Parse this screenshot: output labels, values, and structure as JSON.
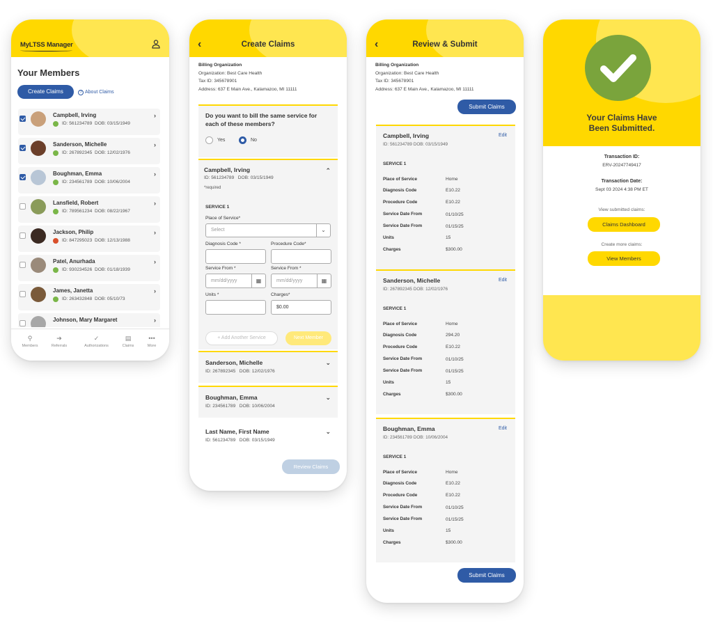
{
  "members_screen": {
    "logo": "MyLTSS Manager",
    "heading": "Your Members",
    "create_claims": "Create Claims",
    "about_claims": "About Claims",
    "members": [
      {
        "name": "Campbell, Irving",
        "id": "ID: 561234789",
        "dob": "DOB: 03/15/1949",
        "checked": true,
        "status": "ok"
      },
      {
        "name": "Sanderson, Michelle",
        "id": "ID: 267892345",
        "dob": "DOB: 12/02/1976",
        "checked": true,
        "status": "ok"
      },
      {
        "name": "Boughman, Emma",
        "id": "ID: 234561789",
        "dob": "DOB: 10/06/2004",
        "checked": true,
        "status": "ok"
      },
      {
        "name": "Lansfield, Robert",
        "id": "ID: 789561234",
        "dob": "DOB: 08/22/1967",
        "checked": false,
        "status": "ok"
      },
      {
        "name": "Jackson, Philip",
        "id": "ID: 847295023",
        "dob": "DOB: 12/13/1988",
        "checked": false,
        "status": "bad"
      },
      {
        "name": "Patel, Anurhada",
        "id": "ID: 930234526",
        "dob": "DOB: 01/18/1939",
        "checked": false,
        "status": "ok"
      },
      {
        "name": "James, Janetta",
        "id": "ID: 263432848",
        "dob": "DOB: 05/10/73",
        "checked": false,
        "status": "ok"
      },
      {
        "name": "Johnson, Mary Margaret",
        "id": "",
        "dob": "",
        "checked": false,
        "status": "ok"
      }
    ],
    "nav": [
      "Members",
      "Referrals",
      "Authorizations",
      "Claims",
      "More"
    ]
  },
  "create_screen": {
    "title": "Create Claims",
    "billing_label": "Billing Organization",
    "organization": "Organization:   Best Care Health",
    "tax_id": "Tax ID:   345678901",
    "address": "Address:   637 E Main Ave., Kalamazoo, MI 11111",
    "question": "Do you want to bill the same service for each of these members?",
    "yes": "Yes",
    "no": "No",
    "member": {
      "name": "Campbell, Irving",
      "id": "ID: 561234789",
      "dob": "DOB: 03/15/1949"
    },
    "required": "*required",
    "service": "SERVICE 1",
    "place_label": "Place of Service*",
    "place_placeholder": "Select",
    "diagnosis_label": "Diagnosis Code *",
    "procedure_label": "Procedure Code*",
    "service_from_label": "Service From *",
    "service_from_label2": "Service From *",
    "date_placeholder": "mm/dd/yyyy",
    "units_label": "Units *",
    "charges_label": "Charges*",
    "charges_value": "$0.00",
    "add_service": "+ Add Another Service",
    "next_member": "Next Member",
    "collapsed": [
      {
        "name": "Sanderson, Michelle",
        "id": "ID: 267892345",
        "dob": "DOB: 12/02/1976"
      },
      {
        "name": "Boughman, Emma",
        "id": "ID: 234561789",
        "dob": "DOB: 10/06/2004"
      },
      {
        "name": "Last Name, First Name",
        "id": "ID: 561234789",
        "dob": "DOB: 03/15/1949"
      }
    ],
    "review": "Review Claims"
  },
  "review_screen": {
    "title": "Review & Submit",
    "billing_label": "Billing Organization",
    "organization": "Organization:   Best Care Health",
    "tax_id": "Tax ID:   345678901",
    "address": "Address:   637 E Main Ave., Kalamazoo, MI 11111",
    "submit": "Submit Claims",
    "edit": "Edit",
    "service": "SERVICE 1",
    "keys": [
      "Place of Service",
      "Diagnosis Code",
      "Procedure Code",
      "Service Date From",
      "Service Date From",
      "Units",
      "Charges"
    ],
    "claims": [
      {
        "name": "Campbell, Irving",
        "meta": "ID: 561234789   DOB: 03/15/1949",
        "values": [
          "Home",
          "E10.22",
          "E10.22",
          "01/10/25",
          "01/15/25",
          "15",
          "$300.00"
        ]
      },
      {
        "name": "Sanderson, Michelle",
        "meta": "ID: 267892345   DOB: 12/02/1976",
        "values": [
          "Home",
          "294.20",
          "E10.22",
          "01/10/25",
          "01/15/25",
          "15",
          "$300.00"
        ]
      },
      {
        "name": "Boughman, Emma",
        "meta": "ID: 234561789   DOB: 10/06/2004",
        "values": [
          "Home",
          "E10.22",
          "E10.22",
          "01/10/25",
          "01/15/25",
          "15",
          "$300.00"
        ]
      }
    ]
  },
  "success_screen": {
    "title_line1": "Your Claims Have",
    "title_line2": "Been Submitted.",
    "transaction_id_label": "Transaction ID:",
    "transaction_id": "ERV-20247749417",
    "transaction_date_label": "Transaction Date:",
    "transaction_date": "Sept 03 2024 4:38 PM ET",
    "view_submitted": "View submitted claims:",
    "dashboard": "Claims Dashboard",
    "create_more": "Create more claims:",
    "view_members": "View Members"
  },
  "colors": {
    "brand_yellow": "#ffd800",
    "primary_blue": "#2f5ba6",
    "success_green": "#7aa43c",
    "error_orange": "#d9502b"
  }
}
